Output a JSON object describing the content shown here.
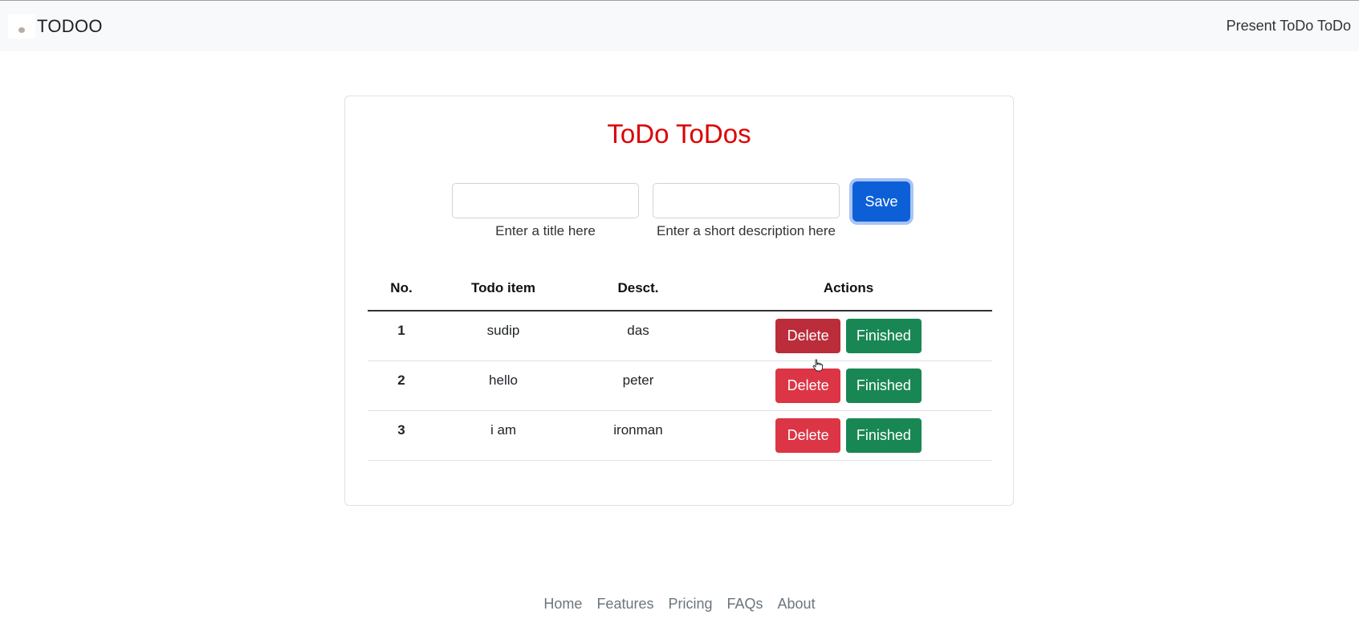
{
  "navbar": {
    "brand": "TODOO",
    "right_link": "Present ToDo ToDo"
  },
  "card": {
    "title": "ToDo ToDos"
  },
  "form": {
    "title_value": "",
    "title_hint": "Enter a title here",
    "desc_value": "",
    "desc_hint": "Enter a short description here",
    "save_label": "Save"
  },
  "table": {
    "headers": [
      "No.",
      "Todo item",
      "Desct.",
      "Actions"
    ],
    "rows": [
      {
        "no": "1",
        "item": "sudip",
        "desc": "das"
      },
      {
        "no": "2",
        "item": "hello",
        "desc": "peter"
      },
      {
        "no": "3",
        "item": "i am",
        "desc": "ironman"
      }
    ],
    "delete_label": "Delete",
    "finished_label": "Finished"
  },
  "footer": {
    "links": [
      "Home",
      "Features",
      "Pricing",
      "FAQs",
      "About"
    ]
  },
  "colors": {
    "title_red": "#dc0000",
    "save_blue": "#0d5fd8",
    "delete_red": "#dc3545",
    "finished_green": "#198754"
  }
}
